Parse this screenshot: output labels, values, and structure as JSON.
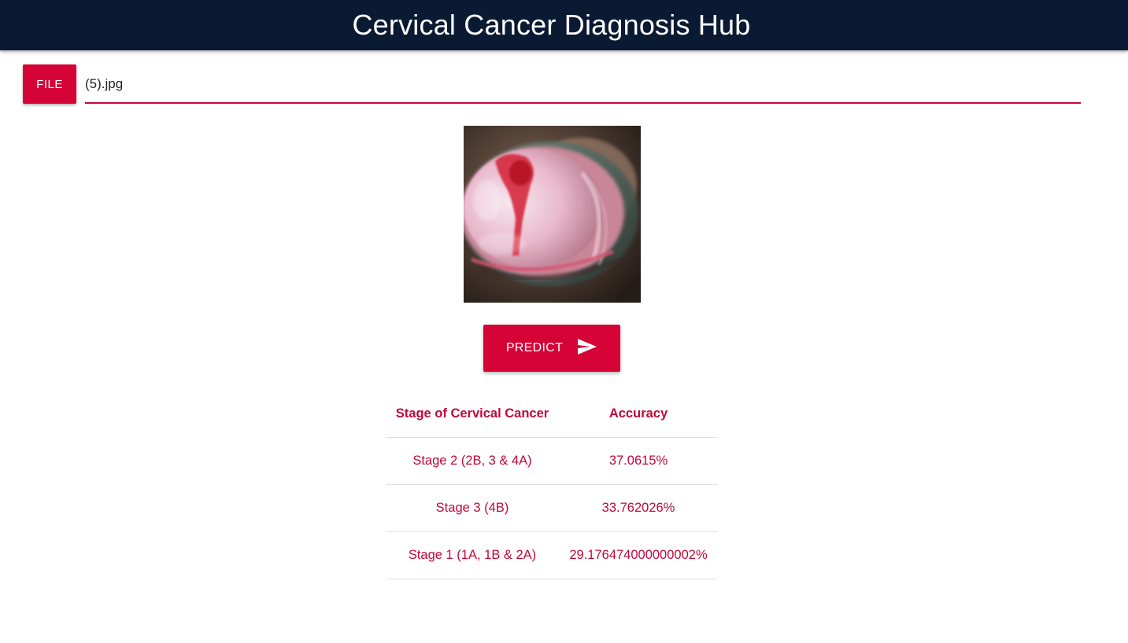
{
  "header": {
    "title": "Cervical Cancer Diagnosis Hub",
    "background": "#0b1a33"
  },
  "upload": {
    "file_button_label": "FILE",
    "file_name": "(5).jpg"
  },
  "preview": {
    "icon": "cervical-image"
  },
  "predict": {
    "label": "PREDICT",
    "icon": "send-icon"
  },
  "results": {
    "headers": [
      "Stage of Cervical Cancer",
      "Accuracy"
    ],
    "rows": [
      {
        "stage": "Stage 2 (2B, 3 & 4A)",
        "accuracy": "37.0615%"
      },
      {
        "stage": "Stage 3 (4B)",
        "accuracy": "33.762026%"
      },
      {
        "stage": "Stage 1 (1A, 1B & 2A)",
        "accuracy": "29.176474000000002%"
      }
    ]
  },
  "colors": {
    "accent": "#d50336",
    "text_accent": "#c2073a"
  }
}
